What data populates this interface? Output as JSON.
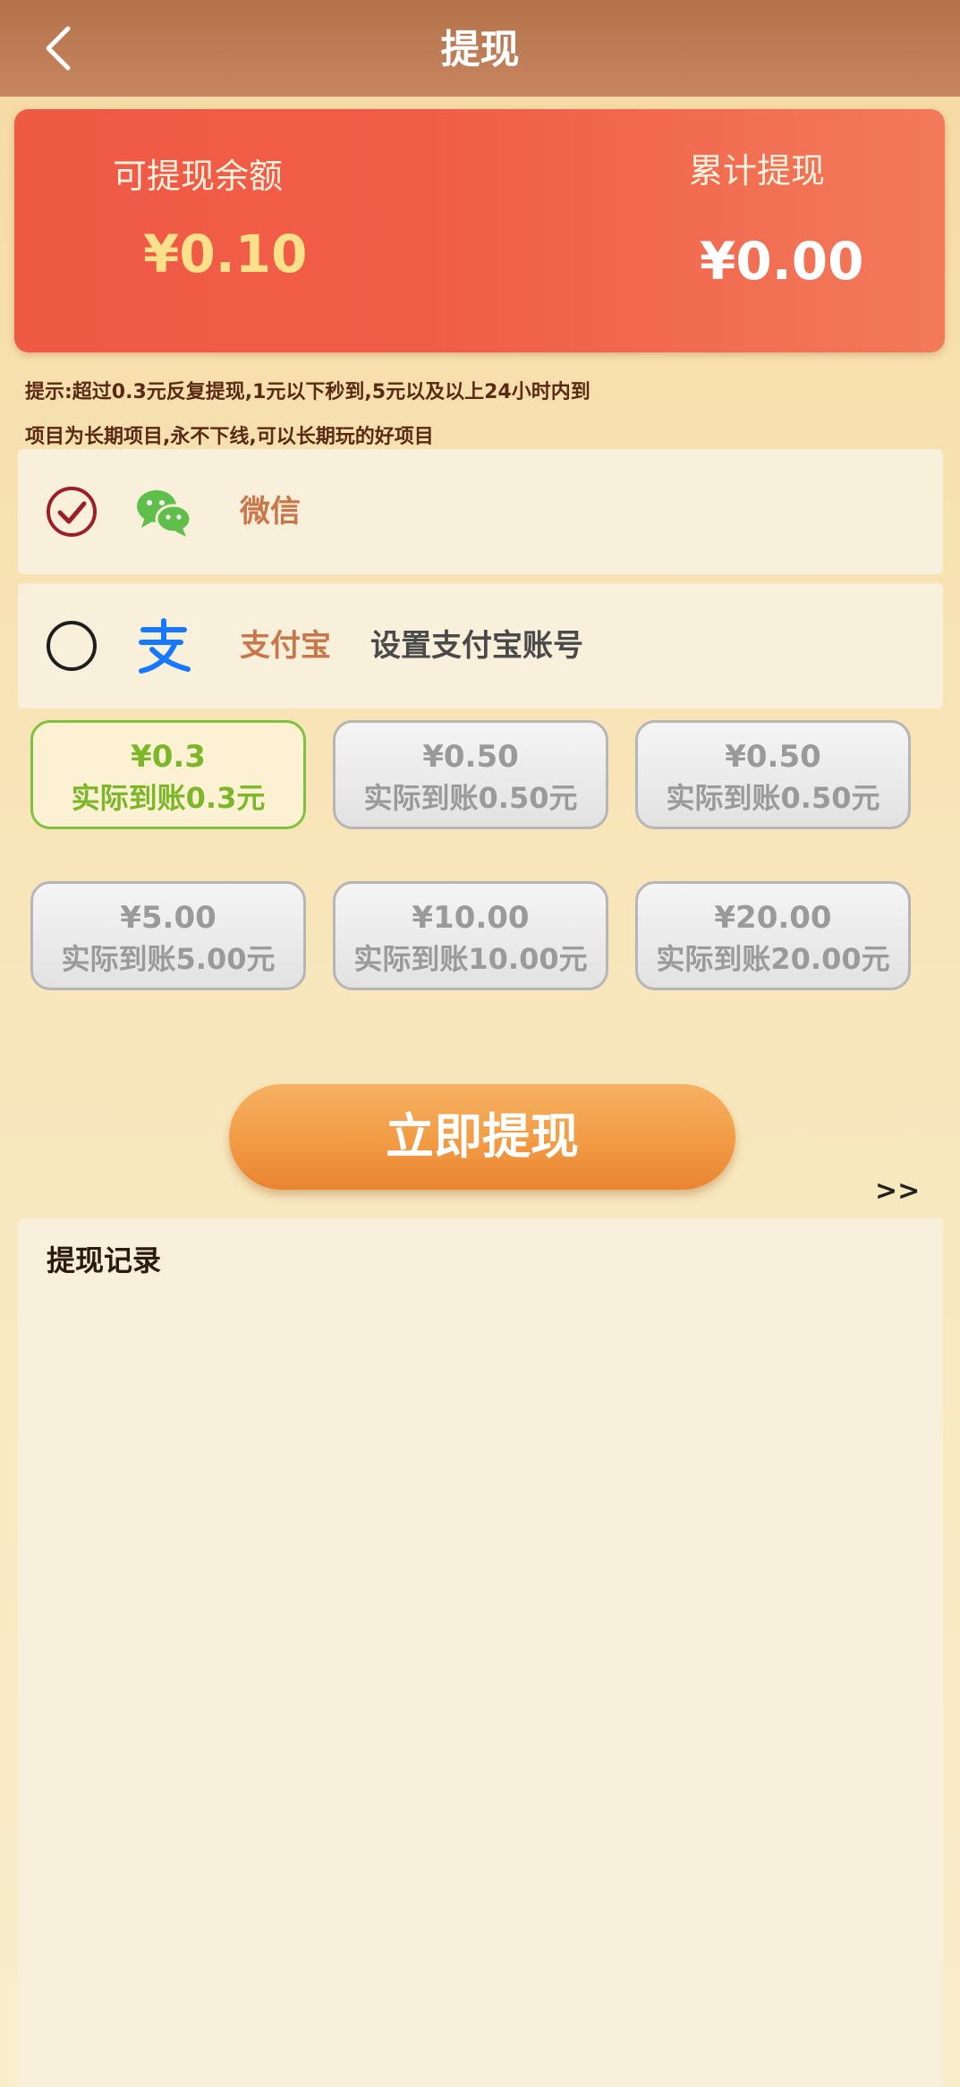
{
  "header": {
    "title": "提现",
    "back_icon": "chevron-left-icon"
  },
  "balance": {
    "available_label": "可提现余额",
    "available_amount": "¥0.10",
    "total_label": "累计提现",
    "total_amount": "¥0.00"
  },
  "tips": {
    "line1": "提示:超过0.3元反复提现,1元以下秒到,5元以及以上24小时内到",
    "line2": "项目为长期项目,永不下线,可以长期玩的好项目"
  },
  "payment_methods": [
    {
      "name": "微信",
      "icon": "wechat-icon",
      "selected": true,
      "extra": ""
    },
    {
      "name": "支付宝",
      "icon": "alipay-icon",
      "selected": false,
      "extra": "设置支付宝账号"
    }
  ],
  "amount_options": [
    {
      "amount": "¥0.3",
      "actual": "实际到账0.3元",
      "selected": true
    },
    {
      "amount": "¥0.50",
      "actual": "实际到账0.50元",
      "selected": false
    },
    {
      "amount": "¥0.50",
      "actual": "实际到账0.50元",
      "selected": false
    },
    {
      "amount": "¥5.00",
      "actual": "实际到账5.00元",
      "selected": false
    },
    {
      "amount": "¥10.00",
      "actual": "实际到账10.00元",
      "selected": false
    },
    {
      "amount": "¥20.00",
      "actual": "实际到账20.00元",
      "selected": false
    }
  ],
  "actions": {
    "withdraw_label": "立即提现",
    "more_label": ">>"
  },
  "records": {
    "title": "提现记录"
  },
  "colors": {
    "header_bg": "#b97a52",
    "card_red": "#ef5a45",
    "amount_gold": "#fde08a",
    "selected_green": "#7cb72a",
    "button_orange": "#f29b45"
  }
}
